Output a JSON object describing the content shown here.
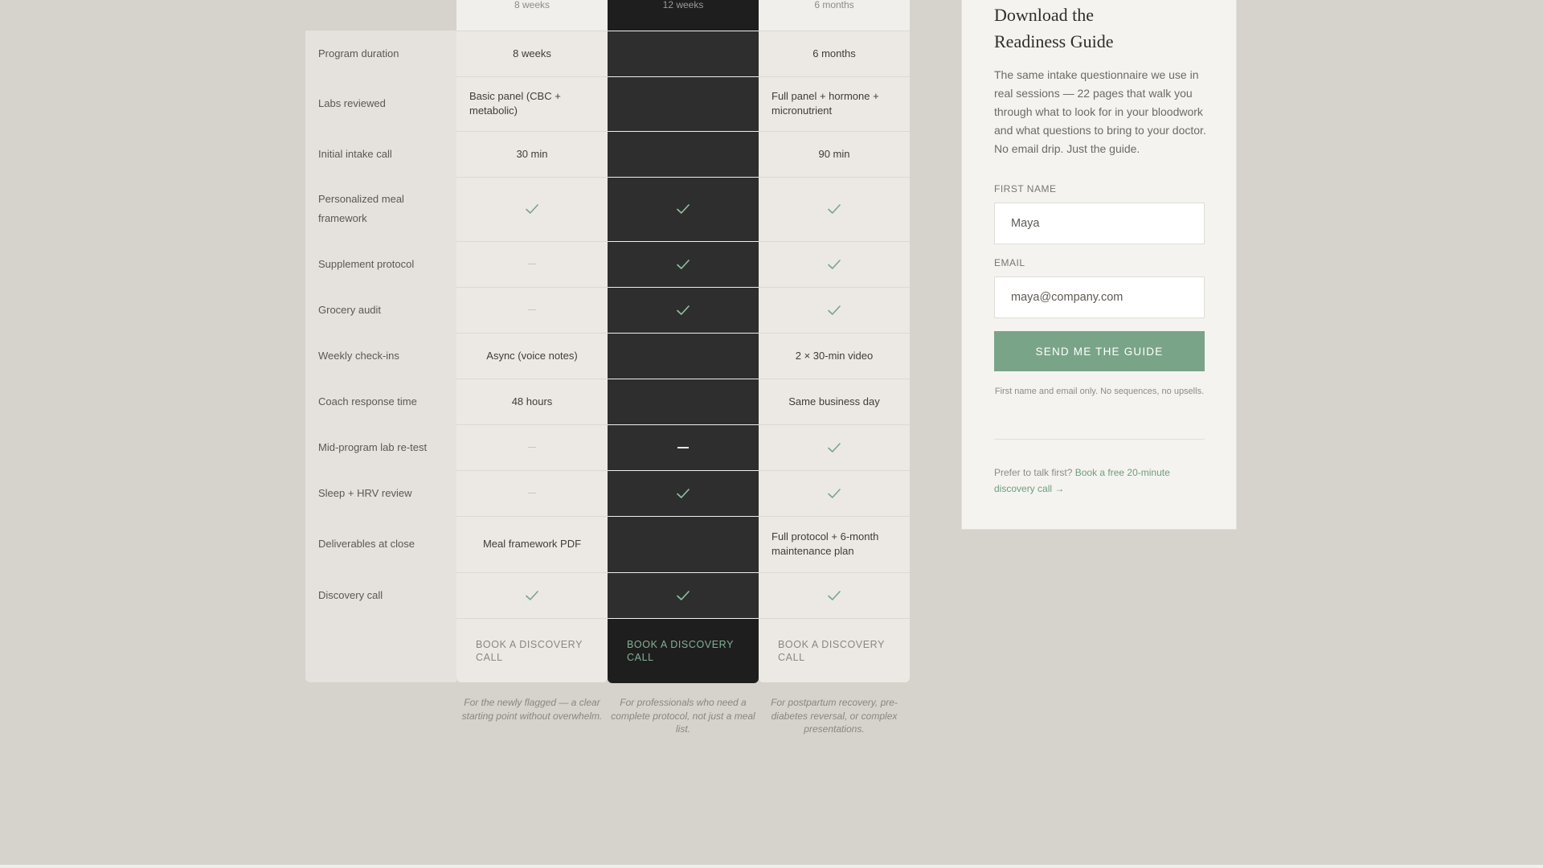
{
  "plans": [
    {
      "duration_header": "8 weeks",
      "cta": "BOOK A DISCOVERY CALL",
      "tagline": "For the newly flagged — a clear starting point without overwhelm."
    },
    {
      "duration_header": "12 weeks",
      "cta": "BOOK A DISCOVERY CALL",
      "tagline": "For professionals who need a complete protocol, not just a meal list."
    },
    {
      "duration_header": "6 months",
      "cta": "BOOK A DISCOVERY CALL",
      "tagline": "For postpartum recovery, pre-diabetes reversal, or complex presentations."
    }
  ],
  "rows": [
    {
      "label": "Program duration",
      "cells": [
        {
          "text": "8 weeks"
        },
        {
          "text": ""
        },
        {
          "text": "6 months"
        }
      ]
    },
    {
      "label": "Labs reviewed",
      "cells": [
        {
          "text": "Basic panel (CBC + metabolic)"
        },
        {
          "text": ""
        },
        {
          "text": "Full panel + hormone + micronutrient"
        }
      ]
    },
    {
      "label": "Initial intake call",
      "cells": [
        {
          "text": "30 min"
        },
        {
          "text": ""
        },
        {
          "text": "90 min"
        }
      ]
    },
    {
      "label": "Personalized meal framework",
      "cells": [
        {
          "icon": "check"
        },
        {
          "icon": "check"
        },
        {
          "icon": "check"
        }
      ]
    },
    {
      "label": "Supplement protocol",
      "cells": [
        {
          "icon": "dash"
        },
        {
          "icon": "check"
        },
        {
          "icon": "check"
        }
      ]
    },
    {
      "label": "Grocery audit",
      "cells": [
        {
          "icon": "dash"
        },
        {
          "icon": "check"
        },
        {
          "icon": "check"
        }
      ]
    },
    {
      "label": "Weekly check-ins",
      "cells": [
        {
          "text": "Async (voice notes)"
        },
        {
          "text": ""
        },
        {
          "text": "2 × 30-min video"
        }
      ]
    },
    {
      "label": "Coach response time",
      "cells": [
        {
          "text": "48 hours"
        },
        {
          "text": ""
        },
        {
          "text": "Same business day"
        }
      ]
    },
    {
      "label": "Mid-program lab re-test",
      "cells": [
        {
          "icon": "dash"
        },
        {
          "icon": "dash"
        },
        {
          "icon": "check"
        }
      ]
    },
    {
      "label": "Sleep + HRV review",
      "cells": [
        {
          "icon": "dash"
        },
        {
          "icon": "check"
        },
        {
          "icon": "check"
        }
      ]
    },
    {
      "label": "Deliverables at close",
      "cells": [
        {
          "text": "Meal framework PDF"
        },
        {
          "text": ""
        },
        {
          "text": "Full protocol + 6-month maintenance plan"
        }
      ]
    },
    {
      "label": "Discovery call",
      "cells": [
        {
          "icon": "check"
        },
        {
          "icon": "check"
        },
        {
          "icon": "check"
        }
      ]
    }
  ],
  "guide": {
    "title": "Download the Readiness Guide",
    "description": "The same intake questionnaire we use in real sessions — 22 pages that walk you through what to look for in your bloodwork and what questions to bring to your doctor. No email drip. Just the guide.",
    "first_name_label": "FIRST NAME",
    "first_name_value": "Maya",
    "email_label": "EMAIL",
    "email_value": "maya@company.com",
    "submit_label": "SEND ME THE GUIDE",
    "privacy_note": "First name and email only. No sequences, no upsells.",
    "talk_prefix": "Prefer to talk first?",
    "talk_link": "Book a free 20-minute discovery call →"
  },
  "colors": {
    "accent_green": "#7aa487",
    "featured_column": "#2e2e2e",
    "page_background": "#d6d2cc"
  }
}
